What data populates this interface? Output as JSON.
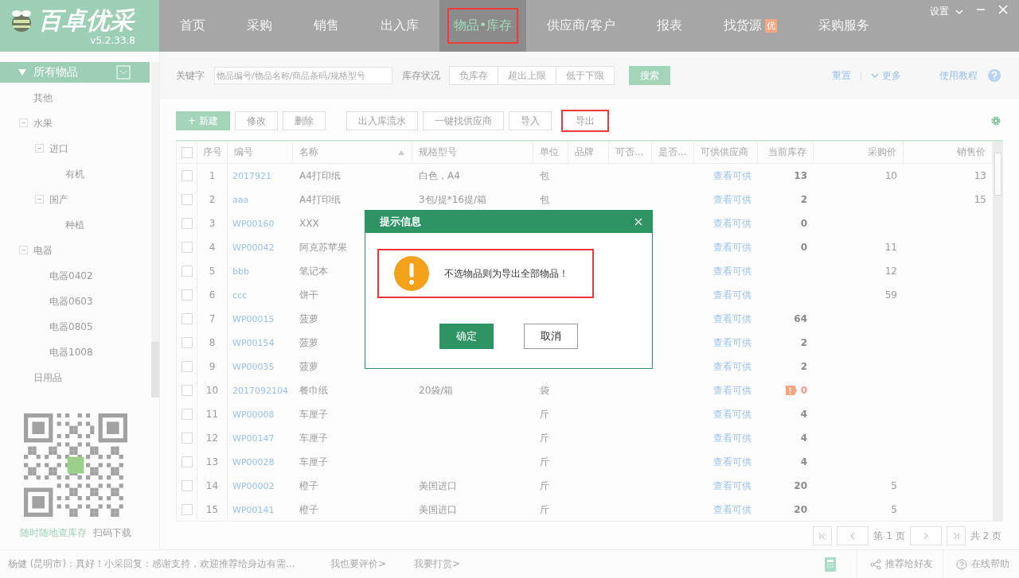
{
  "app": {
    "logo": "百卓优采",
    "version": "v5.2.33.8",
    "settings": "设置"
  },
  "nav": [
    {
      "label": "首页",
      "selected": false,
      "highlighted": false
    },
    {
      "label": "采购",
      "selected": false,
      "highlighted": false
    },
    {
      "label": "销售",
      "selected": false,
      "highlighted": false
    },
    {
      "label": "出入库",
      "selected": false,
      "highlighted": false
    },
    {
      "label": "物品•库存",
      "selected": true,
      "highlighted": true
    },
    {
      "label": "供应商/客户",
      "selected": false,
      "highlighted": false
    },
    {
      "label": "报表",
      "selected": false,
      "highlighted": false
    },
    {
      "label": "找货源",
      "badge": "优",
      "selected": false,
      "highlighted": false
    },
    {
      "label": "采购服务",
      "selected": false,
      "highlighted": false
    }
  ],
  "sidebar": {
    "title": "所有物品",
    "tree": [
      {
        "label": "其他"
      },
      {
        "label": "水果",
        "expanded": true,
        "children": [
          {
            "label": "进口",
            "expanded": true,
            "children": [
              {
                "label": "有机"
              }
            ]
          },
          {
            "label": "国产",
            "expanded": true,
            "children": [
              {
                "label": "种植"
              }
            ]
          }
        ]
      },
      {
        "label": "电器",
        "expanded": true,
        "children": [
          {
            "label": "电器0402"
          },
          {
            "label": "电器0603"
          },
          {
            "label": "电器0805"
          },
          {
            "label": "电器1008"
          }
        ]
      },
      {
        "label": "日用品"
      }
    ],
    "qr_caption": "随时随地查库存",
    "qr_hint": "扫码下载"
  },
  "search": {
    "keyword_label": "关键字",
    "placeholder": "物品编号/物品名称/商品条码/规格型号",
    "stock_label": "库存状况",
    "stock_filters": [
      "负库存",
      "超出上限",
      "低于下限"
    ],
    "search_button": "搜索",
    "reset": "重置",
    "more": "更多",
    "tutorial": "使用教程"
  },
  "toolbar": [
    {
      "label": "+ 新建",
      "kind": "primary",
      "highlighted": false
    },
    {
      "label": "修改",
      "kind": "plain",
      "highlighted": false
    },
    {
      "label": "删除",
      "kind": "plain",
      "highlighted": false
    },
    {
      "label": "出入库流水",
      "kind": "plain",
      "highlighted": false
    },
    {
      "label": "一键找供应商",
      "kind": "plain",
      "highlighted": false
    },
    {
      "label": "导入",
      "kind": "plain",
      "highlighted": false
    },
    {
      "label": "导出",
      "kind": "plain",
      "highlighted": true
    }
  ],
  "table": {
    "all_checked": false,
    "columns": [
      {
        "label": "序号",
        "sorted": false
      },
      {
        "label": "编号",
        "sorted": false
      },
      {
        "label": "名称",
        "sorted": true
      },
      {
        "label": "规格型号",
        "sorted": false
      },
      {
        "label": "单位",
        "sorted": false
      },
      {
        "label": "品牌",
        "sorted": false
      },
      {
        "label": "可否...",
        "sorted": false
      },
      {
        "label": "是否...",
        "sorted": false
      },
      {
        "label": "可供供应商",
        "sorted": false
      },
      {
        "label": "当前库存",
        "sorted": false
      },
      {
        "label": "采购价",
        "sorted": false
      },
      {
        "label": "销售价",
        "sorted": false
      }
    ],
    "rows": [
      {
        "no": "1",
        "code": "2017921",
        "name": "A4打印纸",
        "spec": "白色，A4",
        "unit": "包",
        "supplier": "查看可供",
        "stock": "13",
        "stock_warning": false,
        "buy": "10",
        "sell": "13",
        "checked": false
      },
      {
        "no": "2",
        "code": "aaa",
        "name": "A4打印纸",
        "spec": "3包/提*16提/箱",
        "unit": "包",
        "supplier": "查看可供",
        "stock": "2",
        "stock_warning": false,
        "sell": "15",
        "checked": false
      },
      {
        "no": "3",
        "code": "WP00160",
        "name": "XXX",
        "supplier": "查看可供",
        "stock": "0",
        "stock_warning": false,
        "checked": false
      },
      {
        "no": "4",
        "code": "WP00042",
        "name": "阿克苏苹果",
        "supplier": "查看可供",
        "stock": "0",
        "stock_warning": false,
        "buy": "11",
        "checked": false
      },
      {
        "no": "5",
        "code": "bbb",
        "name": "笔记本",
        "supplier": "查看可供",
        "stock_warning": false,
        "buy": "12",
        "checked": false
      },
      {
        "no": "6",
        "code": "ccc",
        "name": "饼干",
        "supplier": "查看可供",
        "stock_warning": false,
        "buy": "59",
        "checked": false
      },
      {
        "no": "7",
        "code": "WP00015",
        "name": "菠萝",
        "supplier": "查看可供",
        "stock": "64",
        "stock_warning": false,
        "checked": false
      },
      {
        "no": "8",
        "code": "WP00154",
        "name": "菠萝",
        "supplier": "查看可供",
        "stock": "2",
        "stock_warning": false,
        "checked": false
      },
      {
        "no": "9",
        "code": "WP00035",
        "name": "菠萝",
        "supplier": "查看可供",
        "stock": "2",
        "stock_warning": false,
        "checked": false
      },
      {
        "no": "10",
        "code": "2017092104",
        "name": "餐巾纸",
        "spec": "20袋/箱",
        "unit": "袋",
        "supplier": "查看可供",
        "stock": "0",
        "stock_warning": true,
        "checked": false
      },
      {
        "no": "11",
        "code": "WP00008",
        "name": "车厘子",
        "unit": "斤",
        "supplier": "查看可供",
        "stock": "4",
        "stock_warning": false,
        "checked": false
      },
      {
        "no": "12",
        "code": "WP00147",
        "name": "车厘子",
        "unit": "斤",
        "supplier": "查看可供",
        "stock": "4",
        "stock_warning": false,
        "checked": false
      },
      {
        "no": "13",
        "code": "WP00028",
        "name": "车厘子",
        "unit": "斤",
        "supplier": "查看可供",
        "stock": "4",
        "stock_warning": false,
        "checked": false
      },
      {
        "no": "14",
        "code": "WP00002",
        "name": "橙子",
        "spec": "美国进口",
        "unit": "斤",
        "supplier": "查看可供",
        "stock": "20",
        "stock_warning": false,
        "buy": "5",
        "checked": false
      },
      {
        "no": "15",
        "code": "WP00141",
        "name": "橙子",
        "spec": "美国进口",
        "unit": "斤",
        "supplier": "查看可供",
        "stock": "20",
        "stock_warning": false,
        "buy": "5",
        "checked": false
      }
    ]
  },
  "pagination": {
    "current": "第 1 页",
    "total": "共 2 页"
  },
  "status_bar": {
    "message": "杨健 (昆明市)：真好！小采回复：感谢支持，欢迎推荐给身边有需...",
    "links": [
      "我也要评价>",
      "我要打赏>"
    ],
    "share": "推荐给好友",
    "help": "在线帮助"
  },
  "dialog": {
    "title": "提示信息",
    "message": "不选物品则为导出全部物品！",
    "message_highlighted": true,
    "buttons": [
      {
        "label": "确定",
        "kind": "primary"
      },
      {
        "label": "取消",
        "kind": "secondary"
      }
    ]
  }
}
